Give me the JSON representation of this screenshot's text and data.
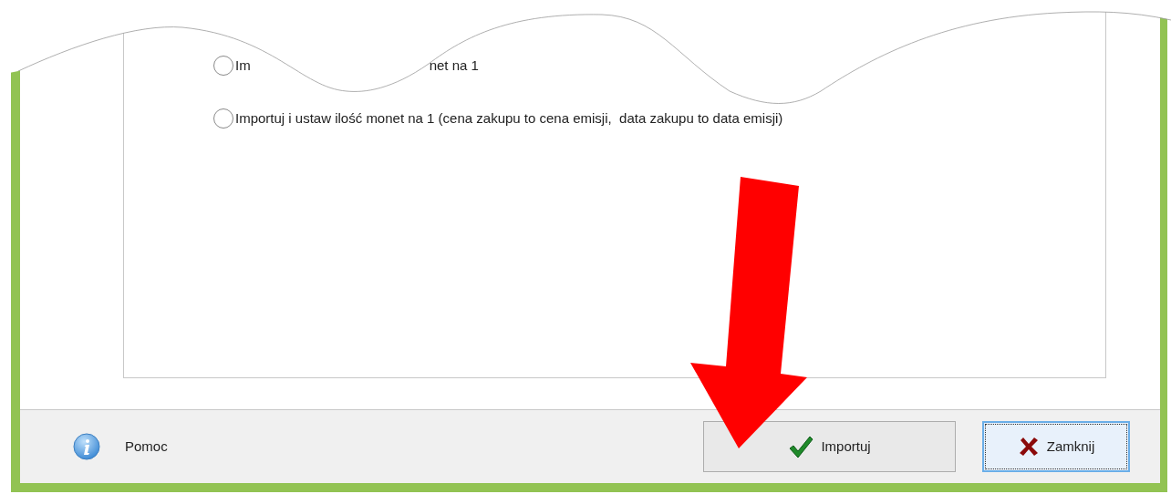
{
  "options": [
    {
      "label_parts": [
        "Im",
        "net na 1"
      ],
      "selected": false
    },
    {
      "label_parts": [
        "Importuj i ustaw ilość monet na 1 (cena zakupu to cena emisji,  data zakupu to data emisji)"
      ],
      "selected": false
    }
  ],
  "footer": {
    "help": "Pomoc",
    "buttons": [
      {
        "label": "Importuj",
        "kind": "confirm",
        "focused": false
      },
      {
        "label": "Zamknij",
        "kind": "close",
        "focused": true
      }
    ]
  }
}
